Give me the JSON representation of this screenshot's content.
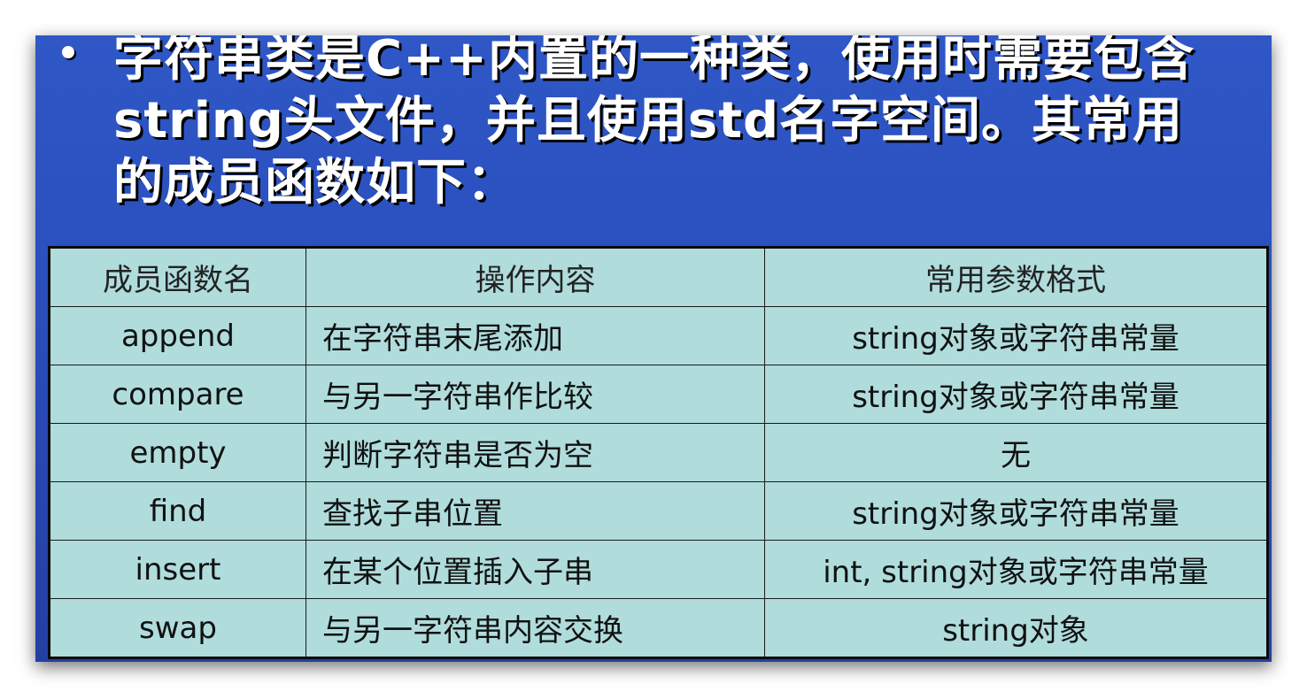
{
  "bullet": {
    "text": "字符串类是C++内置的一种类，使用时需要包含string头文件，并且使用std名字空间。其常用的成员函数如下："
  },
  "table": {
    "headers": [
      "成员函数名",
      "操作内容",
      "常用参数格式"
    ],
    "rows": [
      [
        "append",
        "在字符串末尾添加",
        "string对象或字符串常量"
      ],
      [
        "compare",
        "与另一字符串作比较",
        "string对象或字符串常量"
      ],
      [
        "empty",
        "判断字符串是否为空",
        "无"
      ],
      [
        "find",
        "查找子串位置",
        "string对象或字符串常量"
      ],
      [
        "insert",
        "在某个位置插入子串",
        "int, string对象或字符串常量"
      ],
      [
        "swap",
        "与另一字符串内容交换",
        "string对象"
      ]
    ]
  },
  "colors": {
    "slide_background": "#2b50bf",
    "table_background": "#b0dcdc",
    "bullet_text": "#ffffff"
  }
}
